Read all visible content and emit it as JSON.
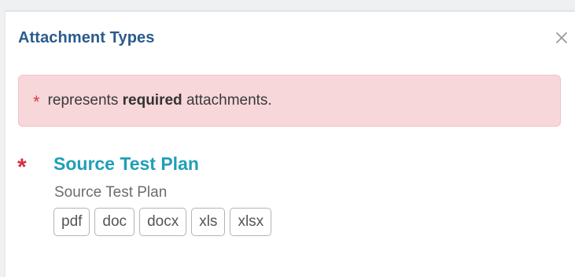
{
  "modal": {
    "title": "Attachment Types",
    "close_icon": "close-icon"
  },
  "alert": {
    "star": "*",
    "prefix": "represents",
    "emphasis": "required",
    "suffix": "attachments."
  },
  "attachments": [
    {
      "required_star": "*",
      "title": "Source Test Plan",
      "description": "Source Test Plan",
      "types": [
        "pdf",
        "doc",
        "docx",
        "xls",
        "xlsx"
      ]
    }
  ],
  "colors": {
    "title": "#2a5b8c",
    "link": "#1f9fb8",
    "required": "#d8303f",
    "alert_bg": "#f7d7da"
  }
}
